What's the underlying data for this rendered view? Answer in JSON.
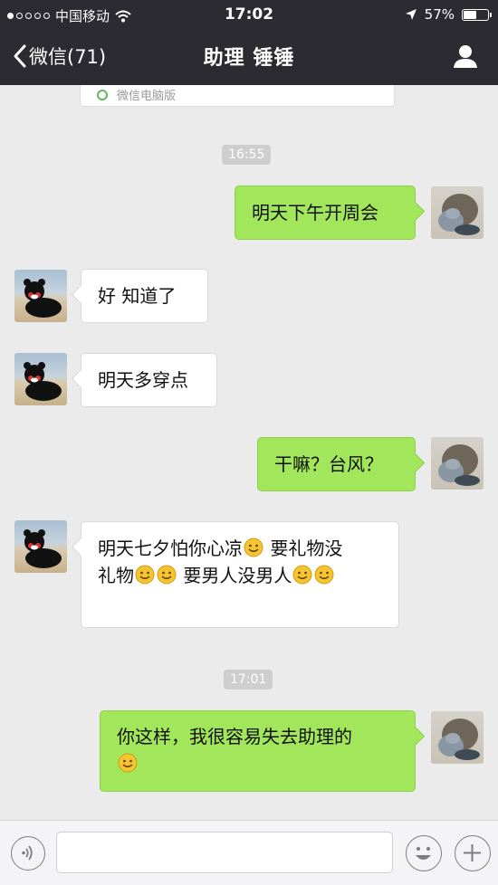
{
  "status_bar": {
    "carrier": "中国移动",
    "time": "17:02",
    "battery": "57%",
    "battery_level": 0.57,
    "signal_bars_filled": 1,
    "signal_bars_total": 5
  },
  "nav": {
    "back_label": "微信(71)",
    "title": "助理 锤锤"
  },
  "chat": {
    "pc_notice": "微信电脑版",
    "timestamps": [
      "16:55",
      "17:01"
    ],
    "messages": [
      {
        "side": "out",
        "sender": "me",
        "text": "明天下午开周会"
      },
      {
        "side": "in",
        "sender": "assistant",
        "text": "好 知道了"
      },
      {
        "side": "in",
        "sender": "assistant",
        "text": "明天多穿点"
      },
      {
        "side": "out",
        "sender": "me",
        "text": "干嘛？台风？"
      },
      {
        "side": "in",
        "sender": "assistant",
        "line1": "明天七夕怕你心凉",
        "line1b": " 要礼物没",
        "line2a": "礼物",
        "line2b": "  要男人没男人"
      },
      {
        "side": "out",
        "sender": "me",
        "text": "你这样，我很容易失去助理的"
      }
    ]
  },
  "colors": {
    "nav_bg": "#2b2b31",
    "chat_bg": "#ebebeb",
    "out_bubble": "#a2e65b",
    "in_bubble": "#ffffff",
    "timestamp_bg": "#cecece"
  },
  "icons": [
    "signal-dots-icon",
    "wifi-icon",
    "location-arrow-icon",
    "battery-icon",
    "back-chevron-icon",
    "person-icon",
    "voice-icon",
    "emoji-face-icon",
    "plus-icon",
    "smile-emoji-icon"
  ]
}
